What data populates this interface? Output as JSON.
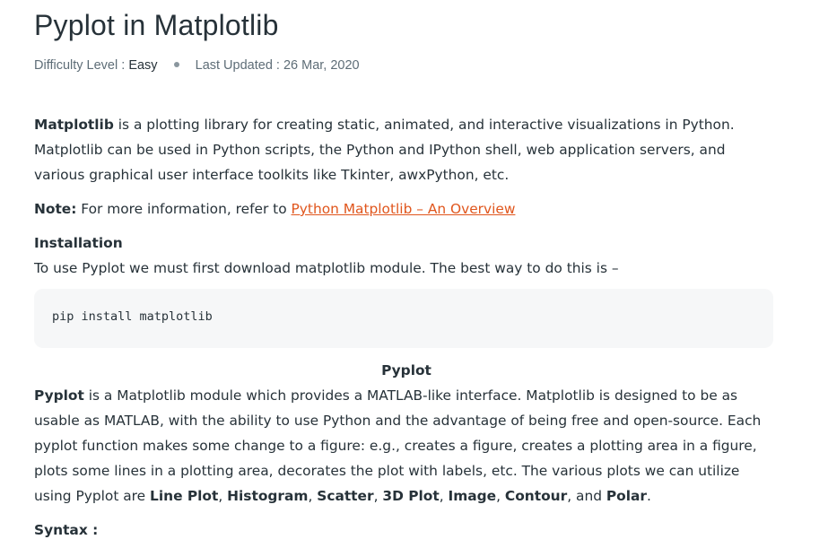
{
  "article": {
    "title": "Pyplot in Matplotlib",
    "meta": {
      "difficulty_label": "Difficulty Level : ",
      "difficulty_value": "Easy",
      "updated_label": "Last Updated : ",
      "updated_value": "26 Mar, 2020"
    },
    "intro": {
      "bold": "Matplotlib",
      "text": " is a plotting library for creating static, animated, and interactive visualizations in Python. Matplotlib can be used in Python scripts, the Python and IPython shell, web application servers, and various graphical user interface toolkits like Tkinter, awxPython, etc."
    },
    "note": {
      "bold": "Note:",
      "text": " For more information, refer to ",
      "link": "Python Matplotlib – An Overview"
    },
    "installation": {
      "heading": "Installation",
      "text": "To use Pyplot we must first download matplotlib module. The best way to do this is –",
      "code": "pip install matplotlib"
    },
    "pyplot": {
      "heading": "Pyplot",
      "bold": "Pyplot",
      "text1": " is a Matplotlib module which provides a MATLAB-like interface. Matplotlib is designed to be as usable as MATLAB, with the ability to use Python and the advantage of being free and open-source. Each pyplot function makes some change to a figure: e.g., creates a figure, creates a plotting area in a figure, plots some lines in a plotting area, decorates the plot with labels, etc. The various plots we can utilize using Pyplot are ",
      "plots": [
        "Line Plot",
        "Histogram",
        "Scatter",
        "3D Plot",
        "Image",
        "Contour",
        "Polar"
      ],
      "sep": ", ",
      "and": ", and ",
      "end": "."
    },
    "syntax_heading": "Syntax :"
  },
  "colors": {
    "text": "#273239",
    "link": "#e0561d",
    "code_bg": "#f6f7f8"
  }
}
